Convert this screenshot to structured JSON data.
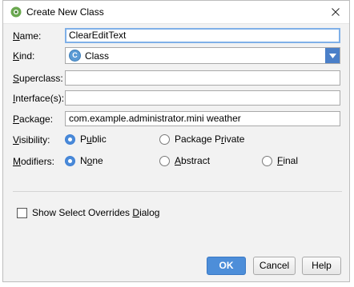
{
  "window": {
    "title": "Create New Class"
  },
  "form": {
    "name": {
      "label_u": "N",
      "label_rest": "ame:",
      "value": "ClearEditText"
    },
    "kind": {
      "label_u": "K",
      "label_rest": "ind:",
      "value": "Class",
      "icon_letter": "C"
    },
    "superclass": {
      "label_u": "S",
      "label_rest": "uperclass:",
      "value": ""
    },
    "interfaces": {
      "label_u": "I",
      "label_rest": "nterface(s):",
      "value": ""
    },
    "package": {
      "label_u": "P",
      "label_rest": "ackage:",
      "value": "com.example.administrator.mini weather"
    },
    "visibility": {
      "label_u": "V",
      "label_rest": "isibility:",
      "options": [
        {
          "pre": "P",
          "u": "u",
          "post": "blic",
          "checked": true
        },
        {
          "pre": "Package P",
          "u": "r",
          "post": "ivate",
          "checked": false
        }
      ]
    },
    "modifiers": {
      "label_u": "M",
      "label_rest": "odifiers:",
      "options": [
        {
          "pre": "N",
          "u": "o",
          "post": "ne",
          "checked": true
        },
        {
          "pre": "",
          "u": "A",
          "post": "bstract",
          "checked": false
        },
        {
          "pre": "",
          "u": "F",
          "post": "inal",
          "checked": false
        }
      ]
    }
  },
  "options": {
    "show_overrides_pre": "Show Select Overrides ",
    "show_overrides_u": "D",
    "show_overrides_post": "ialog",
    "show_overrides_checked": false
  },
  "buttons": {
    "ok": "OK",
    "cancel": "Cancel",
    "help": "Help"
  },
  "icons": {
    "app": "android-studio-icon",
    "close": "close-icon",
    "dropdown": "chevron-down-icon"
  },
  "colors": {
    "accent": "#4d8ed9",
    "focus_border": "#7fb0e8",
    "dialog_bg": "#f2f2f2"
  }
}
